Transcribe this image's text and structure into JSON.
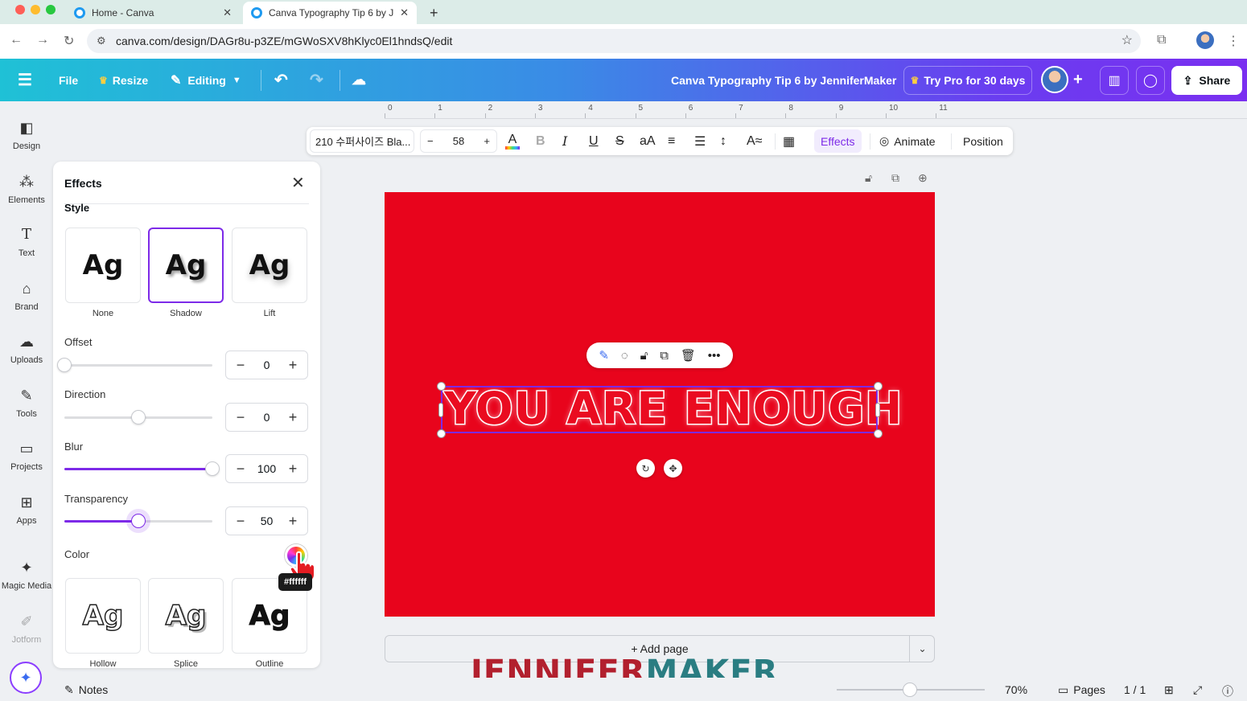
{
  "browser": {
    "tabs": [
      {
        "title": "Home - Canva",
        "active": false
      },
      {
        "title": "Canva Typography Tip 6 by J",
        "active": true
      }
    ],
    "new_tab": "+",
    "url": "canva.com/design/DAGr8u-p3ZE/mGWoSXV8hKlyc0El1hndsQ/edit"
  },
  "header": {
    "menu_icon": "hamburger-icon",
    "file": "File",
    "resize": "Resize",
    "editing": "Editing",
    "doc_title": "Canva Typography Tip 6 by JenniferMaker",
    "try_pro": "Try Pro for 30 days",
    "share": "Share",
    "colors": {
      "gradient_start": "#1fc1d6",
      "gradient_end": "#7a2ff0"
    }
  },
  "rail": {
    "items": [
      {
        "label": "Design",
        "icon": "design-icon"
      },
      {
        "label": "Elements",
        "icon": "elements-icon"
      },
      {
        "label": "Text",
        "icon": "text-icon"
      },
      {
        "label": "Brand",
        "icon": "brand-icon"
      },
      {
        "label": "Uploads",
        "icon": "uploads-icon"
      },
      {
        "label": "Tools",
        "icon": "tools-icon"
      },
      {
        "label": "Projects",
        "icon": "projects-icon"
      },
      {
        "label": "Apps",
        "icon": "apps-icon"
      },
      {
        "label": "Magic Media",
        "icon": "magic-media-icon"
      },
      {
        "label": "Jotform",
        "icon": "jotform-icon"
      }
    ]
  },
  "effects_panel": {
    "title": "Effects",
    "style_heading": "Style",
    "styles_top": [
      {
        "name": "None",
        "sample": "Ag",
        "selected": false
      },
      {
        "name": "Shadow",
        "sample": "Ag",
        "selected": true
      },
      {
        "name": "Lift",
        "sample": "Ag",
        "selected": false
      }
    ],
    "offset": {
      "label": "Offset",
      "value": "0",
      "percent": 0
    },
    "direction": {
      "label": "Direction",
      "value": "0",
      "percent": 50
    },
    "blur": {
      "label": "Blur",
      "value": "100",
      "percent": 100
    },
    "transparency": {
      "label": "Transparency",
      "value": "50",
      "percent": 50
    },
    "color": {
      "label": "Color",
      "tooltip": "#ffffff"
    },
    "styles_bottom": [
      {
        "name": "Hollow",
        "sample": "Ag"
      },
      {
        "name": "Splice",
        "sample": "Ag"
      },
      {
        "name": "Outline",
        "sample": "Ag"
      }
    ],
    "accent": "#7d2ae8"
  },
  "ruler": {
    "marks": [
      "0",
      "1",
      "2",
      "3",
      "4",
      "5",
      "6",
      "7",
      "8",
      "9",
      "10",
      "11"
    ]
  },
  "toolbar": {
    "font": "210 수퍼사이즈 Bla...",
    "size": "58",
    "minus": "−",
    "plus": "+",
    "effects": "Effects",
    "animate": "Animate",
    "position": "Position"
  },
  "design": {
    "text": "YOU ARE ENOUGH",
    "background": "#e8041c",
    "text_color": "#ea0b20",
    "stroke_color": "#ffffff"
  },
  "add_page": "+ Add page",
  "watermark": {
    "part1": "JENNIFER",
    "part2": "MAKER"
  },
  "footer": {
    "notes": "Notes",
    "zoom": "70%",
    "pages": "Pages",
    "page_count": "1 / 1",
    "zoom_level_percent": 45
  }
}
